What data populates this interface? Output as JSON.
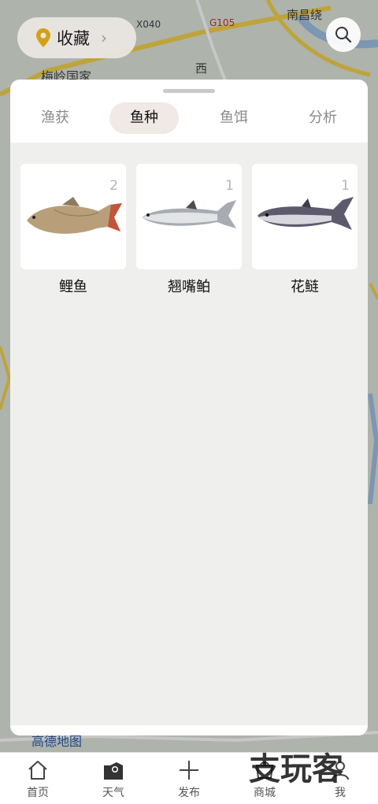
{
  "map": {
    "labels": [
      "X040",
      "G105",
      "南昌绕",
      "西",
      "梅岭国家",
      "高德地图"
    ]
  },
  "topbar": {
    "favorite_label": "收藏",
    "favorite_icon": "location-pin-icon",
    "search_icon": "search-icon"
  },
  "tabs": [
    {
      "label": "渔获",
      "active": false
    },
    {
      "label": "鱼种",
      "active": true
    },
    {
      "label": "鱼饵",
      "active": false
    },
    {
      "label": "分析",
      "active": false
    }
  ],
  "fish": [
    {
      "name": "鲤鱼",
      "count": "2"
    },
    {
      "name": "翘嘴鲌",
      "count": "1"
    },
    {
      "name": "花鲢",
      "count": "1"
    }
  ],
  "bottom_nav": [
    {
      "label": "首页",
      "icon": "home-icon"
    },
    {
      "label": "天气",
      "icon": "weather-icon"
    },
    {
      "label": "发布",
      "icon": "plus-icon"
    },
    {
      "label": "商城",
      "icon": "shop-icon"
    },
    {
      "label": "我",
      "icon": "user-icon"
    }
  ],
  "watermark": "支玩客",
  "colors": {
    "active_tab_bg": "#f0e9e6",
    "pin": "#d4a017"
  }
}
